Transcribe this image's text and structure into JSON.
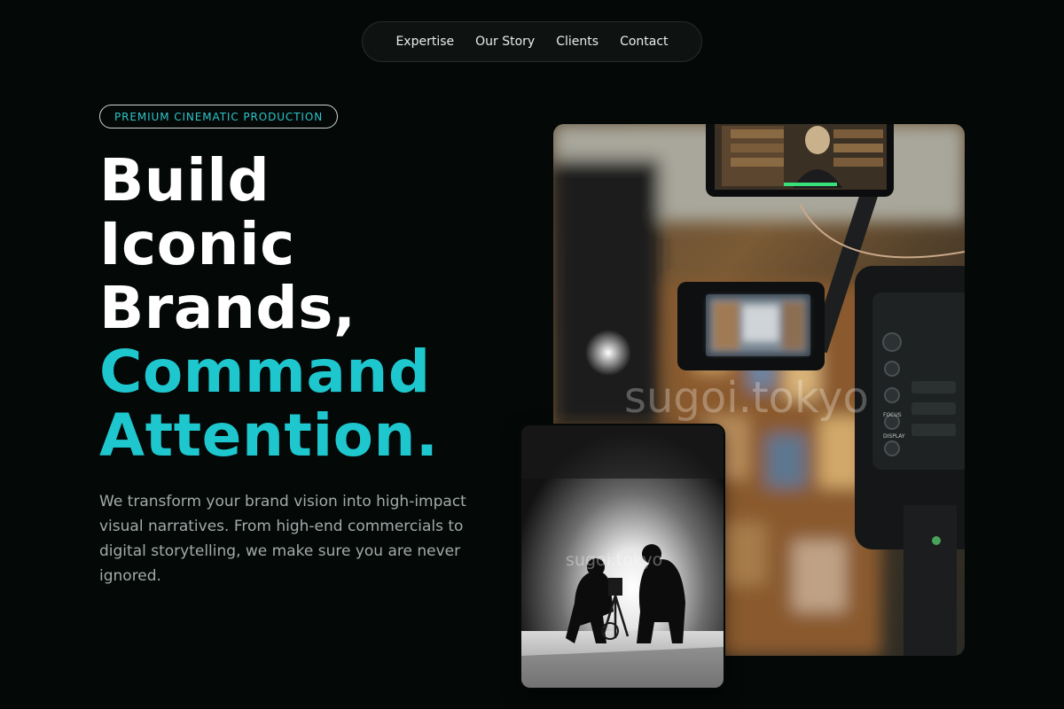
{
  "nav": {
    "items": [
      {
        "label": "Expertise"
      },
      {
        "label": "Our Story"
      },
      {
        "label": "Clients"
      },
      {
        "label": "Contact"
      }
    ]
  },
  "hero": {
    "tag": "PREMIUM CINEMATIC PRODUCTION",
    "headline_white": [
      "Build",
      "Iconic",
      "Brands,"
    ],
    "headline_accent": [
      "Command",
      "Attention."
    ],
    "description": "We transform your brand vision into high-impact visual narratives. From high-end commercials to digital storytelling, we make sure you are never ignored."
  },
  "images": {
    "main_watermark": "sugoi.tokyo",
    "small_watermark": "sugoi.tokyo",
    "camera_labels": {
      "focus": "FOCUS",
      "display": "DISPLAY"
    }
  },
  "colors": {
    "background": "#040807",
    "accent": "#1ec7cd",
    "body_text": "#a3aaaa"
  }
}
